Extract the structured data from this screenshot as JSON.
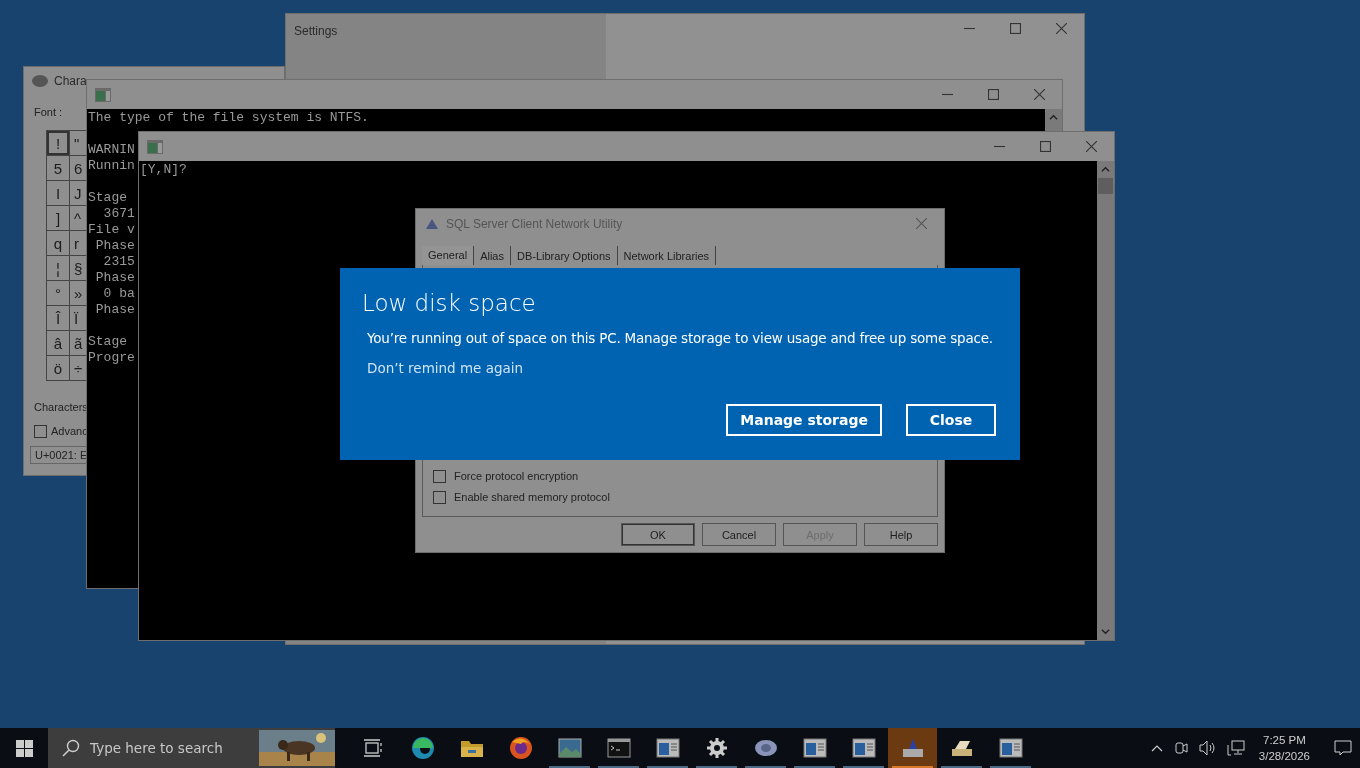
{
  "character_map": {
    "title": "Chara",
    "font_label": "Font :",
    "grid": [
      [
        {
          "char": "!",
          "selected": true
        },
        {
          "char": "\"",
          "selected": false
        }
      ],
      [
        {
          "char": "5",
          "selected": false
        },
        {
          "char": "6",
          "selected": false
        }
      ],
      [
        {
          "char": "I",
          "selected": false
        },
        {
          "char": "J",
          "selected": false
        }
      ],
      [
        {
          "char": "]",
          "selected": false
        },
        {
          "char": "^",
          "selected": false
        }
      ],
      [
        {
          "char": "q",
          "selected": false
        },
        {
          "char": "r",
          "selected": false
        }
      ],
      [
        {
          "char": "¦",
          "selected": false
        },
        {
          "char": "§",
          "selected": false
        }
      ],
      [
        {
          "char": "°",
          "selected": false
        },
        {
          "char": "»",
          "selected": false
        }
      ],
      [
        {
          "char": "Î",
          "selected": false
        },
        {
          "char": "Ï",
          "selected": false
        }
      ],
      [
        {
          "char": "â",
          "selected": false
        },
        {
          "char": "ã",
          "selected": false
        }
      ],
      [
        {
          "char": "ö",
          "selected": false
        },
        {
          "char": "÷",
          "selected": false
        }
      ]
    ],
    "characters_label": "Characters",
    "advanced": {
      "label": "Advanc",
      "checked": false
    },
    "status": "U+0021: E"
  },
  "settings": {
    "title": "Settings"
  },
  "console_back": {
    "paragraphs": [
      [
        "The type of the file system is NTFS."
      ],
      [
        "WARNIN",
        "Runnin"
      ],
      [
        "Stage",
        "  3671",
        "File v",
        " Phase",
        "  2315",
        " Phase",
        "  0 ba",
        " Phase"
      ],
      [
        "Stage",
        "Progre"
      ]
    ]
  },
  "console_front": {
    "paragraphs": [
      [
        "[Y,N]?"
      ]
    ]
  },
  "sql_dialog": {
    "title": "SQL Server Client Network Utility",
    "tabs": [
      {
        "label": "General",
        "selected": true
      },
      {
        "label": "Alias",
        "selected": false
      },
      {
        "label": "DB-Library Options",
        "selected": false
      },
      {
        "label": "Network Libraries",
        "selected": false
      }
    ],
    "options": [
      {
        "label": "Force protocol encryption",
        "checked": false
      },
      {
        "label": "Enable shared memory protocol",
        "checked": false
      }
    ],
    "buttons": [
      {
        "label": "OK",
        "disabled": false,
        "default": true
      },
      {
        "label": "Cancel",
        "disabled": false,
        "default": false
      },
      {
        "label": "Apply",
        "disabled": true,
        "default": false
      },
      {
        "label": "Help",
        "disabled": false,
        "default": false
      }
    ]
  },
  "toast": {
    "title": "Low disk space",
    "message": "You’re running out of space on this PC. Manage storage to view usage and free up some space.",
    "link": "Don’t remind me again",
    "buttons": [
      "Manage storage",
      "Close"
    ]
  },
  "taskbar": {
    "search": {
      "placeholder": "Type here to search"
    },
    "apps": [
      {
        "kind": "taskview",
        "active": false,
        "running": false
      },
      {
        "kind": "edge",
        "active": false,
        "running": false
      },
      {
        "kind": "folder",
        "active": false,
        "running": false
      },
      {
        "kind": "firefox",
        "active": false,
        "running": false
      },
      {
        "kind": "photos",
        "active": false,
        "running": true
      },
      {
        "kind": "terminal",
        "active": false,
        "running": true
      },
      {
        "kind": "window",
        "active": false,
        "running": true
      },
      {
        "kind": "gear",
        "active": false,
        "running": true
      },
      {
        "kind": "charmap",
        "active": false,
        "running": true
      },
      {
        "kind": "window",
        "active": false,
        "running": true
      },
      {
        "kind": "window",
        "active": false,
        "running": true
      },
      {
        "kind": "utility",
        "active": true,
        "running": true
      },
      {
        "kind": "scanner",
        "active": false,
        "running": true
      },
      {
        "kind": "window",
        "active": false,
        "running": true
      }
    ],
    "clock": {
      "time": "7:25 PM",
      "date": "3/28/2026"
    }
  }
}
